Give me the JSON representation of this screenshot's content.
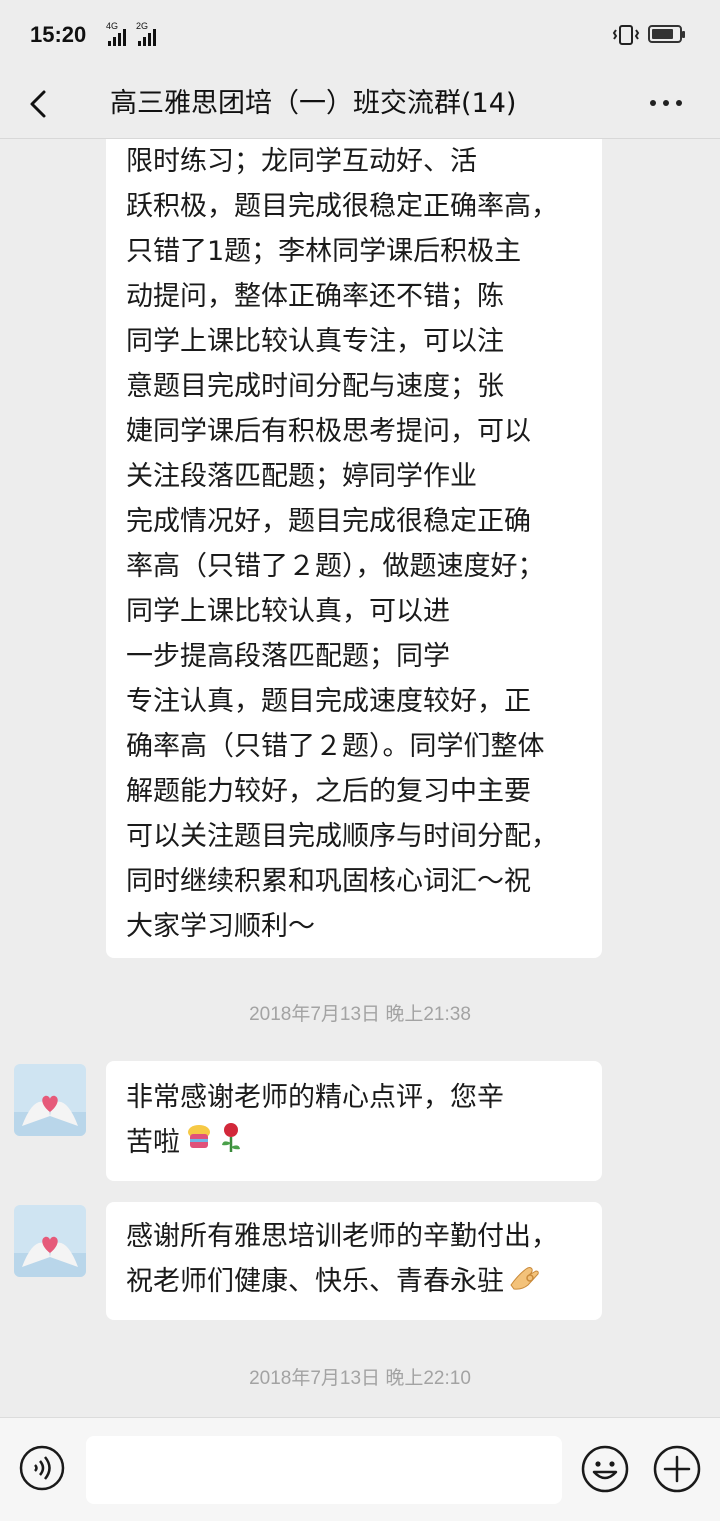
{
  "status_bar": {
    "time": "15:20",
    "net_1": "4G",
    "net_2": "2G"
  },
  "header": {
    "title": "高三雅思团培（一）班交流群(14)"
  },
  "messages": [
    {
      "type": "text",
      "side": "left",
      "lines": [
        "限时练习；龙同学互动好、活",
        "跃积极，题目完成很稳定正确率高，",
        "只错了1题；李林同学课后积极主",
        "动提问，整体正确率还不错；陈",
        "同学上课比较认真专注，可以注",
        "意题目完成时间分配与速度；张",
        "婕同学课后有积极思考提问，可以",
        "关注段落匹配题；婷同学作业",
        "完成情况好，题目完成很稳定正确",
        "率高（只错了２题），做题速度好；",
        "同学上课比较认真，可以进",
        "一步提高段落匹配题；同学",
        "专注认真，题目完成速度较好，正",
        "确率高（只错了２题）。同学们整体",
        "解题能力较好，之后的复习中主要",
        "可以关注题目完成顺序与时间分配，",
        "同时继续积累和巩固核心词汇～祝",
        "大家学习顺利～"
      ]
    },
    {
      "type": "time",
      "text": "2018年7月13日 晚上21:38"
    },
    {
      "type": "text",
      "side": "left",
      "lines": [
        "非常感谢老师的精心点评，您辛",
        "苦啦"
      ]
    },
    {
      "type": "text",
      "side": "left",
      "lines": [
        "感谢所有雅思培训老师的辛勤付出，",
        "祝老师们健康、快乐、青春永驻"
      ]
    },
    {
      "type": "time",
      "text": "2018年7月13日 晚上22:10"
    }
  ],
  "input_bar": {
    "placeholder": ""
  },
  "colors": {
    "background": "#ededed",
    "bubble": "#ffffff",
    "timestamp": "#a3a3a3"
  },
  "icons": {
    "back": "chevron-left-icon",
    "more": "more-dots-icon",
    "voice": "voice-icon",
    "emoji": "smile-icon",
    "plus": "plus-icon"
  }
}
